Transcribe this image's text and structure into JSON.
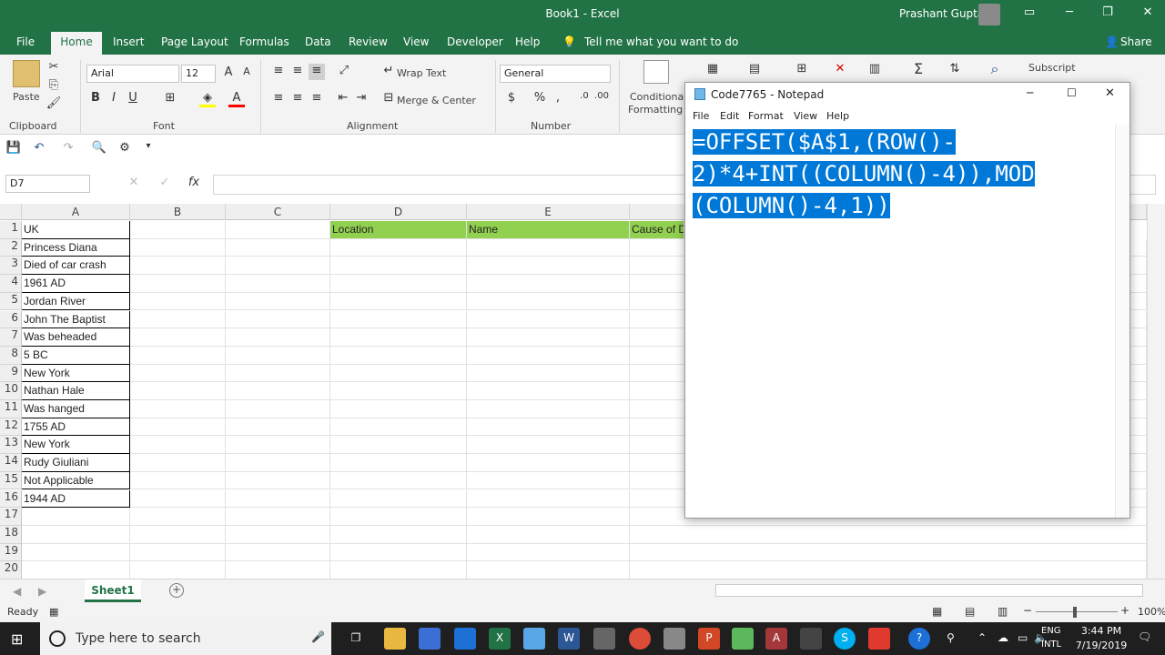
{
  "excel": {
    "title": "Book1 - Excel",
    "user": "Prashant Gupta",
    "tabs": [
      "File",
      "Home",
      "Insert",
      "Page Layout",
      "Formulas",
      "Data",
      "Review",
      "View",
      "Developer",
      "Help"
    ],
    "tell_me": "Tell me what you want to do",
    "share": "Share",
    "ribbon": {
      "paste": "Paste",
      "font_name": "Arial",
      "font_size": "12",
      "wrap_text": "Wrap Text",
      "merge_center": "Merge & Center",
      "number_format": "General",
      "conditional_1": "Conditional",
      "conditional_2": "Formatting",
      "subscript": "Subscript",
      "groups": {
        "clipboard": "Clipboard",
        "font": "Font",
        "alignment": "Alignment",
        "number": "Number"
      },
      "bold": "B",
      "italic": "I",
      "underline": "U",
      "currency": "$",
      "percent": "%",
      "comma": ","
    },
    "name_box": "D7",
    "fx": "fx",
    "formula": "",
    "columns": [
      "A",
      "B",
      "C",
      "D",
      "E"
    ],
    "rows": [
      "1",
      "2",
      "3",
      "4",
      "5",
      "6",
      "7",
      "8",
      "9",
      "10",
      "11",
      "12",
      "13",
      "14",
      "15",
      "16",
      "17",
      "18",
      "19",
      "20"
    ],
    "col_a": [
      "UK",
      "Princess Diana",
      "Died of car crash",
      "1961 AD",
      "Jordan River",
      "John The Baptist",
      "Was beheaded",
      "5 BC",
      "New York",
      "Nathan Hale",
      "Was hanged",
      "1755 AD",
      "New York",
      "Rudy Giuliani",
      "Not Applicable",
      "1944 AD"
    ],
    "headers": {
      "location": "Location",
      "name": "Name",
      "cause": "Cause of D"
    },
    "sheet_tab": "Sheet1",
    "status": "Ready",
    "zoom": "100%"
  },
  "notepad": {
    "title": "Code7765 - Notepad",
    "menu": [
      "File",
      "Edit",
      "Format",
      "View",
      "Help"
    ],
    "lines": [
      "=OFFSET($A$1,(ROW()-",
      "2)*4+INT((COLUMN()-4)),MOD",
      "(COLUMN()-4,1))"
    ]
  },
  "taskbar": {
    "search": "Type here to search",
    "lang1": "ENG",
    "lang2": "INTL",
    "time": "3:44 PM",
    "date": "7/19/2019"
  },
  "colors": {
    "excel_green": "#217346",
    "header_fill": "#92d050",
    "selection": "#0078d7"
  }
}
